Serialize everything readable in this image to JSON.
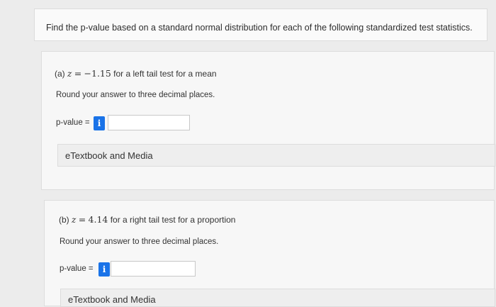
{
  "question": {
    "text": "Find the p-value based on a standard normal distribution for each of the following standardized test statistics."
  },
  "part_a": {
    "label": "(a)",
    "variable": "z",
    "equals": "=",
    "value": "−1.15",
    "description": "for a left tail test for a mean",
    "instruction": "Round your answer to three decimal places.",
    "answer_label": "p-value =",
    "answer_value": "",
    "info_icon": "i",
    "resource_link": "eTextbook and Media"
  },
  "part_b": {
    "label": "(b)",
    "variable": "z",
    "equals": "=",
    "value": "4.14",
    "description": "for a right tail test for a proportion",
    "instruction": "Round your answer to three decimal places.",
    "answer_label": "p-value =",
    "answer_value": "",
    "info_icon": "i",
    "resource_link": "eTextbook and Media"
  },
  "colors": {
    "accent": "#1a73e8",
    "background": "#ececec",
    "panel": "#f7f7f7"
  }
}
